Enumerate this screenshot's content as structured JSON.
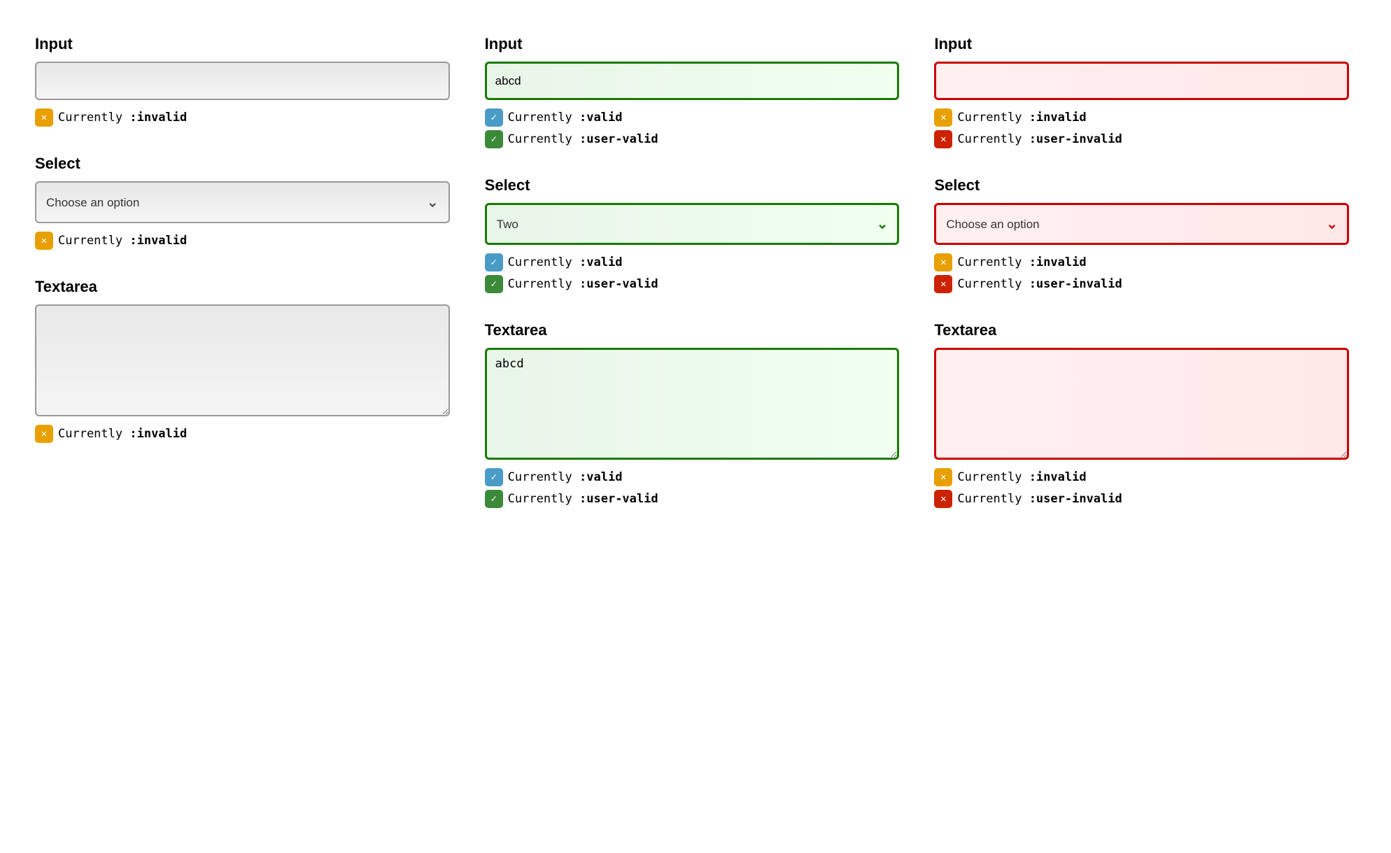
{
  "columns": [
    {
      "id": "col-default",
      "sections": [
        {
          "type": "input",
          "label": "Input",
          "variant": "default",
          "value": "",
          "placeholder": "",
          "statuses": [
            {
              "badge": "orange-x",
              "text": "Currently :invalid"
            }
          ]
        },
        {
          "type": "select",
          "label": "Select",
          "variant": "default",
          "value": "",
          "placeholder": "Choose an option",
          "chevron": "gray",
          "statuses": [
            {
              "badge": "orange-x",
              "text": "Currently :invalid"
            }
          ]
        },
        {
          "type": "textarea",
          "label": "Textarea",
          "variant": "default",
          "value": "",
          "statuses": [
            {
              "badge": "orange-x",
              "text": "Currently :invalid"
            }
          ]
        }
      ]
    },
    {
      "id": "col-valid",
      "sections": [
        {
          "type": "input",
          "label": "Input",
          "variant": "valid",
          "value": "abcd",
          "placeholder": "",
          "statuses": [
            {
              "badge": "blue-check",
              "text": "Currently :valid"
            },
            {
              "badge": "green-check",
              "text": "Currently :user-valid"
            }
          ]
        },
        {
          "type": "select",
          "label": "Select",
          "variant": "valid",
          "value": "Two",
          "placeholder": "Two",
          "chevron": "green",
          "statuses": [
            {
              "badge": "blue-check",
              "text": "Currently :valid"
            },
            {
              "badge": "green-check",
              "text": "Currently :user-valid"
            }
          ]
        },
        {
          "type": "textarea",
          "label": "Textarea",
          "variant": "valid",
          "value": "abcd",
          "statuses": [
            {
              "badge": "blue-check",
              "text": "Currently :valid"
            },
            {
              "badge": "green-check",
              "text": "Currently :user-valid"
            }
          ]
        }
      ]
    },
    {
      "id": "col-invalid",
      "sections": [
        {
          "type": "input",
          "label": "Input",
          "variant": "invalid-red",
          "value": "",
          "placeholder": "",
          "statuses": [
            {
              "badge": "orange-x",
              "text": "Currently :invalid"
            },
            {
              "badge": "red-x",
              "text": "Currently :user-invalid"
            }
          ]
        },
        {
          "type": "select",
          "label": "Select",
          "variant": "invalid-red",
          "value": "",
          "placeholder": "Choose an option",
          "chevron": "red",
          "statuses": [
            {
              "badge": "orange-x",
              "text": "Currently :invalid"
            },
            {
              "badge": "red-x",
              "text": "Currently :user-invalid"
            }
          ]
        },
        {
          "type": "textarea",
          "label": "Textarea",
          "variant": "invalid-red",
          "value": "",
          "statuses": [
            {
              "badge": "orange-x",
              "text": "Currently :invalid"
            },
            {
              "badge": "red-x",
              "text": "Currently :user-invalid"
            }
          ]
        }
      ]
    }
  ],
  "badges": {
    "orange-x": {
      "class": "badge-orange badge-x"
    },
    "blue-check": {
      "class": "badge-blue badge-check"
    },
    "green-check": {
      "class": "badge-green badge-check"
    },
    "red-x": {
      "class": "badge-red badge-x"
    }
  }
}
